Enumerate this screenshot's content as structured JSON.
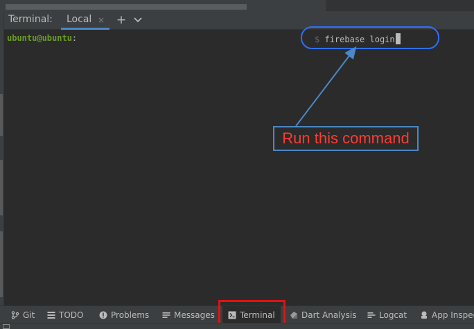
{
  "tool_window": {
    "title": "Terminal:",
    "tabs": [
      {
        "label": "Local",
        "close": "×"
      }
    ],
    "add_tab": "+"
  },
  "terminal": {
    "prompt_user": "ubuntu@ubuntu",
    "prompt_separator": ":",
    "prompt_dollar": "$",
    "command": "firebase login"
  },
  "annotation": {
    "text": "Run this command",
    "text_color": "#ff3b30",
    "highlight_color": "#2f6fff"
  },
  "bottom_bar": {
    "items": [
      {
        "label": "Git",
        "icon": "branch-icon"
      },
      {
        "label": "TODO",
        "icon": "list-icon"
      },
      {
        "label": "Problems",
        "icon": "info-icon"
      },
      {
        "label": "Messages",
        "icon": "list-icon"
      },
      {
        "label": "Terminal",
        "icon": "terminal-icon",
        "active": true
      },
      {
        "label": "Dart Analysis",
        "icon": "dart-icon"
      },
      {
        "label": "Logcat",
        "icon": "logcat-icon"
      },
      {
        "label": "App Inspec",
        "icon": "app-inspector-icon"
      }
    ],
    "highlight_color": "#e01313"
  }
}
